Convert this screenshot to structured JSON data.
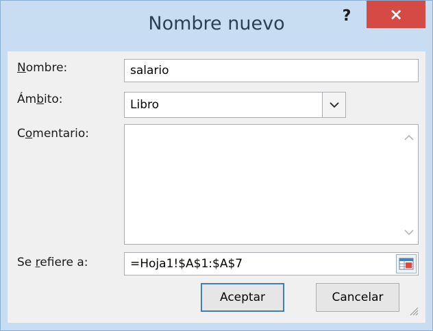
{
  "dialog": {
    "title": "Nombre nuevo",
    "help_label": "?",
    "close_label": "×"
  },
  "fields": {
    "name": {
      "label_pre": "",
      "label_acc": "N",
      "label_post": "ombre:",
      "value": "salario"
    },
    "scope": {
      "label_pre": "Ám",
      "label_acc": "b",
      "label_post": "ito:",
      "value": "Libro"
    },
    "comment": {
      "label_pre": "C",
      "label_acc": "o",
      "label_post": "mentario:",
      "value": ""
    },
    "refers_to": {
      "label_pre": "Se ",
      "label_acc": "r",
      "label_post": "efiere a:",
      "value": "=Hoja1!$A$1:$A$7"
    }
  },
  "buttons": {
    "ok": "Aceptar",
    "cancel": "Cancelar"
  },
  "icons": {
    "close": "close-icon",
    "help": "help-icon",
    "dropdown": "chevron-down-icon",
    "range_selector": "collapse-dialog-icon",
    "resize": "resize-grip-icon"
  },
  "colors": {
    "title_bar": "#c8dcf2",
    "close_button": "#d54a45",
    "default_button_border": "#3c7fb1"
  }
}
